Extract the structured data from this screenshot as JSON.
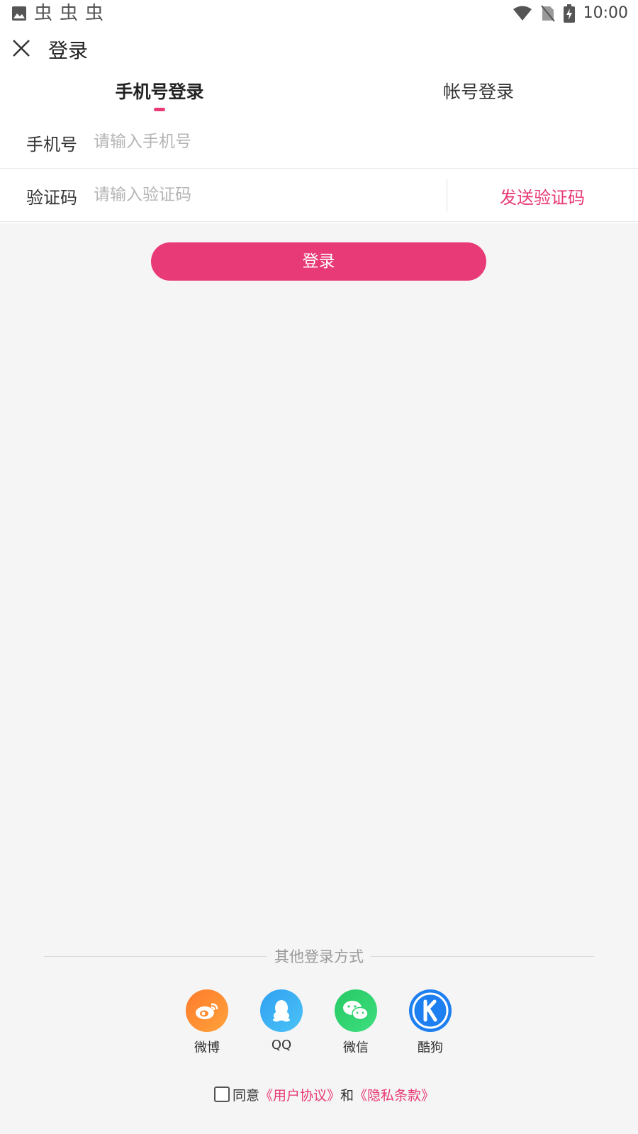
{
  "status_bar": {
    "time": "10:00",
    "notification_icons": [
      "image-icon",
      "bug-icon",
      "bug-icon",
      "bug-icon"
    ],
    "system_icons": [
      "wifi-icon",
      "no-sim-icon",
      "battery-charging-icon"
    ]
  },
  "header": {
    "title": "登录"
  },
  "tabs": [
    {
      "label": "手机号登录",
      "active": true
    },
    {
      "label": "帐号登录",
      "active": false
    }
  ],
  "form": {
    "phone": {
      "label": "手机号",
      "placeholder": "请输入手机号"
    },
    "code": {
      "label": "验证码",
      "placeholder": "请输入验证码"
    },
    "send_code_label": "发送验证码",
    "login_label": "登录"
  },
  "other_login": {
    "title": "其他登录方式",
    "providers": [
      {
        "name": "微博",
        "icon": "weibo-icon",
        "color": "#ff8a2b"
      },
      {
        "name": "QQ",
        "icon": "qq-icon",
        "color": "#3ab0f5"
      },
      {
        "name": "微信",
        "icon": "wechat-icon",
        "color": "#2ed06e"
      },
      {
        "name": "酷狗",
        "icon": "kugou-icon",
        "color": "#1d7ff0"
      }
    ]
  },
  "agreement": {
    "agree_text": "同意",
    "user_agreement": "《用户协议》",
    "and_text": "和",
    "privacy_policy": "《隐私条款》",
    "checked": false
  },
  "colors": {
    "accent": "#e83a76",
    "background": "#f5f5f5"
  }
}
